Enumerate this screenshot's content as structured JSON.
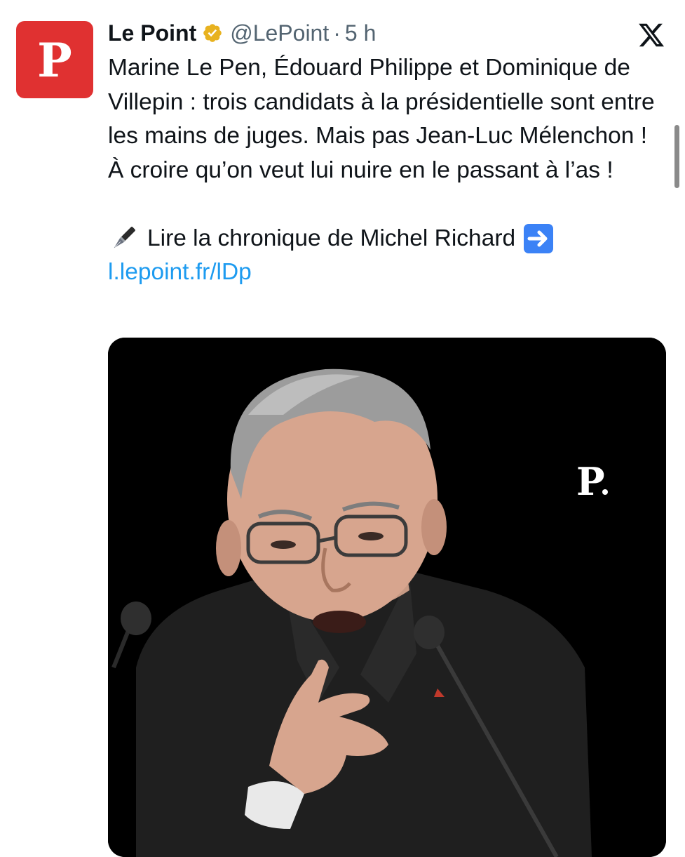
{
  "tweet": {
    "avatar_letter": "P",
    "display_name": "Le Point",
    "handle": "@LePoint",
    "separator": "·",
    "time": "5 h",
    "text_paragraph": "Marine Le Pen, Édouard Philippe et Dominique de Villepin : trois candidats à la présidentielle sont entre les mains de juges. Mais pas Jean-Luc Mélenchon ! À croire qu’on veut lui nuire en le passant à l’as !",
    "cta_text": "Lire la chronique de Michel Richard",
    "link_text": "l.lepoint.fr/lDp",
    "media_brand": "P",
    "icons": {
      "verified": "verified-badge-icon",
      "platform": "x-logo-icon",
      "pen": "fountain-pen-icon",
      "arrow": "right-arrow-icon"
    }
  },
  "colors": {
    "brand_red": "#e03131",
    "link_blue": "#1d9bf0",
    "verified_gold": "#e8b21f",
    "secondary_text": "#536471"
  }
}
